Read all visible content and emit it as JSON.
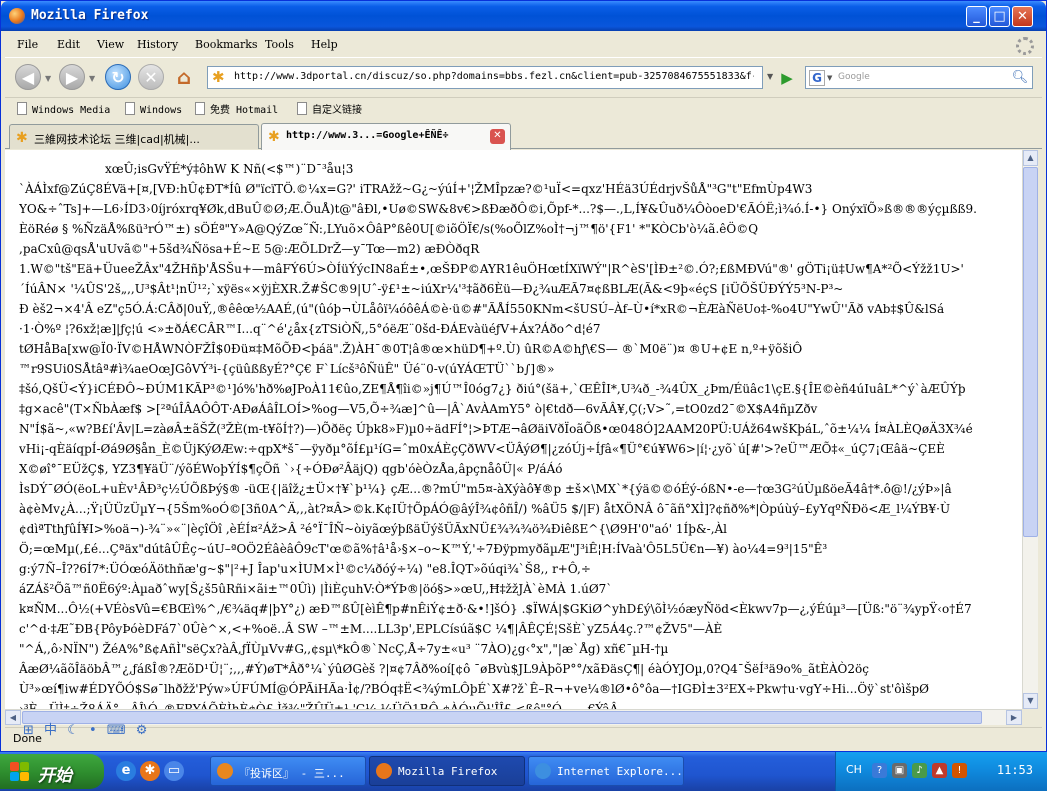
{
  "window": {
    "title": "Mozilla Firefox",
    "controls": {
      "minimize": "_",
      "maximize": "□",
      "close": "✕"
    }
  },
  "menu": [
    "File",
    "Edit",
    "View",
    "History",
    "Bookmarks",
    "Tools",
    "Help"
  ],
  "nav": {
    "back_icon": "back-arrow-icon",
    "forward_icon": "forward-arrow-icon",
    "reload_icon": "reload-icon",
    "stop_icon": "stop-icon",
    "home_icon": "home-icon",
    "url": "http://www.3dportal.cn/discuz/so.php?domains=bbs.fezl.cn&client=pub-3257084675551833&f‹",
    "search_engine": "G",
    "search_placeholder": "Google"
  },
  "bookmarks": [
    "Windows Media",
    "Windows",
    "免费 Hotmail",
    "自定义链接"
  ],
  "tabs": [
    {
      "label": "三維网技术论坛 三维|cad|机械|...",
      "active": false
    },
    {
      "label": "http://www.3...=Google+ÊÑÊ÷",
      "active": true
    }
  ],
  "content_lines": [
    "xœÛ;isGvŸÉ*ý‡ôhW K Nñ(<$™)¨D¯³åu¦3",
    "`ÀÁÌxf@ZúÇ8ÉVä+[¤,[VÐ:hÛ¢ÐT*Íû Ø\"ïcïTÖ.©¼x=G?' iTRAžž~G¿~ýúÍ+'¦ŽMÎpzæ?©¹uÏ<=qxz'HÉä3ÚÉdrjvŠůÅ\"³G\"t\"EfmÙp4W3",
    "YO&÷ˆTs]+—L6›ÍD3›0íjróxrq¥Øk,dBuÛ©Ø;Æ.ÕuÅ)t@\"âÐl,•Uø©SW&8v€>ßÐæðÔ©i,Õpf-*...?$—.,L,Í¥&Ûuð¼ÔòoeD'€ÃÓË;ì¾ó.Í-•} OnýxïÕ»ß®®®ýçµßß9.",
    "ÈöRéø § %ÑzäÅ%ßü³rÓ™±) sÖÉª\"Y»A@QýZœ˜Ñ:,LYuõ×ÔâP°ßê0U[©iõÖÏ€/s(%oÕlZ%oÌ†¬j™¶ö'{F1' *\"KÒCb'ò¼ã.êÖ©Q",
    ",paCxû@qsÅ'uUvã©\"+5šd¾Ñösa+É~E 5@:ÆÕLDrŽ—y¯Tœ—m2) æÐÒðqR",
    "1.W©\"tš\"Eä+ÜueeŽÂx\"4ŽHñþ'ÅSŠu+—mâFÝ6Ú>ÒÍüÝýcIN8aÉ±•,œŠÐP©AYR1êuÖHœtÍXïWÝ\"|R^èS'[ÌÐ±²©.Ó?;£ßMÐVú\"®' gÖTi¡ü‡Uw¶A*²Õ<Ýžž1U>'",
    "´ÍúÂN× '¼ÛS'2š„,,U³$Ât¹¦nÜ¹²;`xÿës«×ÿjÈXR.Ž#ŠC®9|Uˆ-ÿ£¹±~iúXr¼'³‡ãð6Èü—Ð¿¾uÆÃ7¤¢ßBLÆ(Ã&<9þ«éçS [iÜÕŠÜÐÝÝ5³N-P³~",
    "Ð èš2¬×4'Â eZ\"ç5Ó.Á:CÂð|0uŸ,,®êêœ½AAÉ,(ú\"(ûóþ¬ÙLåôï¼óôêÁ©è·ü©#\"ÃÅÍ550KNm<šUSÚ–Àf–Ù•í*xR©¬ÈÆàÑëUo‡-%o4U\"YwÛ''Ãð vAb‡$Û&lSá",
    "·1·Ò%º ¦?6xž¦æ]|ƒç¦ú <»±ðÁ€CÂR™I...q¨^é'¿åx{zTSiÒÑ,,5°óëÆ¨0šd-ÐÁEvàüéƒV+Áx?Áðo^d¦é7",
    "tØHåBa[xw@Ï0·ÏV©HÅWNÒFŽÎ$0Ðü¤‡MõÕÐ<þáä\".Ž)ÀH¯®0T¦â®œ×hüD¶+º.Ù) ûR©A©hƒ\\€S— ®`M0ë¨)¤ ®U+¢E n,º+ÿõšiÔ",
    "™r9SUi0SÅtâª#ì¾aeOœJGôVÝ³i-{çüûßßyÉ?°Ç€ F`Lícš³ôÑüÊ\" Üé¨0-v(úYÁŒTÜ``b∫]®»",
    "‡šó,QšÜ<Ý}iCÉÐÔ~ÐÚM1KÃP³©¹]ó%'hð%øJPoÀ11€ûo,ZE¶Å¶îi©»j¶Ú™Î0óg7¿} ðiú°(šä+,`ŒÊÎI*,U¾ð_-¾4ÛX_¿Þm/Éüâc1\\çE.§{ÎE©èñ4úIuâL*^ý`àÆÛÝþ",
    "‡g×acê\"(T×ÑbÀæf$ >[²ªúÎÂAÔÔT·AÐøÁâÎLOÍ>%og—V5,Õ÷¾æ]^û—|Â`AvÀAmY5° ò|€tdð—6vÃÂ¥,Ç(;V>˜,=tO0zd2¯©X$A4ñµZðv",
    "N\"Í$ã~,«w?B£í'Âv|L=zàøÂ±ãŠŽ(³ŽÈ(m-t¥õÍ†?)—)Õðëç Úþk8»F)µ0÷ädFÍ°¦>ÞTÆ¬âØäiVðÏoãÕß•œ048Ó]2AAM20PÜ:UÁž64wšKþáL,ˆõ±¼¼ Í¤ÀLÈQøÄ3X¾é",
    "vHi¡-qÈäíqpÍ-Øá9Ø§ån_È©ÜjKýØÆw:÷qpX*š¯—ÿyðµ°õÍ£µ¹íG=ˆm0xÁÈçÇðWV<ÜÂýØ¶|¿zóÚj÷Íƒâ«¶Ü°€ú¥W6>|í¦·¿yõ`ú[#'>?eÜ™ÆÕ‡«_úÇ7¡Œâä~ÇEÈ",
    "X©øî°¯EÜžÇ$, YZ3¶¥äÜ¨/ýõÉWoþÝÍ$¶çÕñ `›{÷ÓÐø²ÂäjQ) qgb'óèÒzÅa,âpçnåôÜ|« P/áÁó",
    "ÌsDÝ¯ØÓ(ëoL+uÈv¹ÂÐ³ç½ÚÕßÞý§® -üŒ{|äîž¿±Ü×†¥`þ¹¼} çÆ...®?mÚ\"m5¤-àXýàô¥®p ±š×\\MX`*{ýä©©óÉý-óßN•-e—†œ3G²úÙµßöeÃ4â†*.ô@!/¿ýÞ»|â",
    "à¢èMv¿À...;Ÿ¡ÜÜzÜµY¬{5Šm%oÓ©[3ñ0A^Ä,,,àt?¤Â>©k.K¢IÜ†ÕpÁÓ@âýÎ¾¢ôñÎ/) %âÜ5 $/|F) åtXÖNÂ ô¯ãñ°XÌ]?¢ñð%*|Òpúùý–£yYqºÑÐö<Æ_l¼ÝB¥·Ù",
    "¢dìªTthƒûÍ¥I>%oä¬)-¾¨»«¨|èçîÖî ,èÉÍ¤²Áž>Â ²é°Ï¯ÎÑ~òiyãœýþßäÜýšÜÃxNÜ£¾¾¾ö¾ÐiêßE^{\\Ø9H'0\"aó' 1Íþ&-,Àl",
    "Ö;=œMµ(,£é...Çªäx\"dútâÛÊç~úU–ªOÖ2ÉâèâÔ9cT'œ©ã%†â¹å›§×–o~K™Ý,'÷7ÐÿpmyðãµÆ\"J³iÊ¦H:ÍVaà'Ô5L5Ü€n—¥) ào¼4=9³|15\"Ê³",
    "g:ý7Ñ–Î??6Í7*:ÜÓœóÄöthñæ'g~$\"|²+J Îap'u×ÌUM×Ì¹©c¼ðóý÷¼) \"e8.ÎQT»õúqi¾`Š8,, r+Ô,÷",
    "áZÁš²Õã™ñ0Ë6ýº:Àµaðˆwy[Š¿š5ûRñi×ãi±™0Ûì) |ÌiÈçuhV:Ò*ÝÞ®|öó§>»œU,,Ħ‡žžJÀ`èMÀ 1.úØ7`",
    "k¤ÑM...Ô½(+VÉòsVû=€BŒì%^,/€¾äq#|þY°¿) æÐ™ßÛ[èìÊ¶p#nÊiÝ¢±ð·&•!]šÓ} .$ÏWÁ|$GKiØ^yhD£ý\\õÌ½óæyÑöd<Èkwv7p—¿,ýÉúµ³—[Üß:\"ö¨¾ypŸ‹o†É7",
    "c'^d·‡Æ˜ÐB{PôyÞóèDFá7`0Ûè^×,<+%oë..Â SW –™±M....LL3p',EPLCísúã$C ¼¶|ÂÊÇÉ¦SšÈ`yZ5Á4ç.?™¢ŽV5\"—ÀÈ",
    "\"^Á,,ô›NÏN\") ŽéA%°ß¢AñÌ\"sëÇx?àÂ,ƒÏÙµVv#G,,¢sµ\\*kÔ®`NcÇ,Å÷7y±«u³ ¨7ÀO)¿g‹°x\",\"|æ`Åg) xñ€¯µH-†µ",
    "ÂæØ¼ãõÎäöbÂ™¿,ƒáßÎ®?ÆõD¹Ü¦¨;,,,#Ý)øT*Âð°¼`ýûØGèš ?|¤¢7Âð%oí[¢ô ¯øBvù$JL9ÀþõP°°/xãÐäsÇ¶| éàÓYJOµ,0?Q4¯ŠëÍ³ä9o%_ãtÈÀÒ2öç",
    "Ù³»œí¶iw#ÉDYÕÓ$Sø¯lhðžž'Pýw»ÚFÚMÍ@ÓPÃiHÃa·Ì¢/?BÓq‡Ë<¾ýmLÔþÉ`X#?ž`Ê–R¬+ve¼®lØ•ô°ôa—†IGÐÌ±3²EX÷Pkw†u·vgY÷Hi...Öÿ`st'ôìšpØ",
    "›³È...ÜÌ†÷Ž8ÁÄ°...ÂÎ\\Ó_®FRYÁÕÈÌhÈ¢Ò£ Ìž¾\"ŽÛÜ±¹ 'Ç¼ ¼ÜÖ1BÔ ¢ÀÓµÕ¹'ÎÎ£ <ßê\"°Ó,,,,,,,€ÝâÂ"
  ],
  "status": "Done",
  "ime_icons": [
    "ime-grid-icon",
    "ime-zhong-icon",
    "ime-moon-icon",
    "ime-dot-icon",
    "ime-keyboard-icon",
    "ime-settings-icon"
  ],
  "ime_glyphs": [
    "⊞",
    "中",
    "☾",
    "•",
    "⌨",
    "⚙"
  ],
  "taskbar": {
    "start_label": "开始",
    "quick_launch": [
      "ie-icon",
      "firefox-icon"
    ],
    "items": [
      {
        "label": "『投诉区』 - 三...",
        "active": false,
        "icon_color": "#e8871e"
      },
      {
        "label": "Mozilla Firefox",
        "active": true,
        "icon_color": "#e8761a"
      },
      {
        "label": "Internet Explore...",
        "active": false,
        "icon_color": "#3d8fe0"
      }
    ],
    "tray_lang": "CH",
    "clock": "11:53"
  },
  "colors": {
    "title_bar": "#0a5ee8",
    "taskbar": "#245edb",
    "start": "#2f8f2f",
    "tray": "#0f88dc"
  }
}
